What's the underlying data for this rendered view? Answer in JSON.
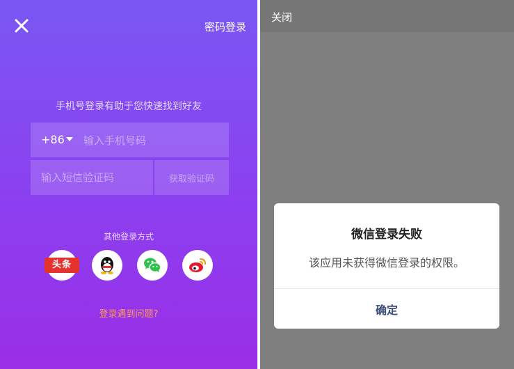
{
  "left": {
    "password_login": "密码登录",
    "hint": "手机号登录有助于您快速找到好友",
    "country_code": "+86",
    "phone_placeholder": "输入手机号码",
    "code_placeholder": "输入短信验证码",
    "get_code": "获取验证码",
    "other_login": "其他登录方式",
    "social": {
      "toutiao_label": "头条",
      "icons": [
        "toutiao-icon",
        "qq-icon",
        "wechat-icon",
        "weibo-icon"
      ]
    },
    "problem_link": "登录遇到问题?",
    "colors": {
      "gradient_top": "#7a57f2",
      "gradient_bottom": "#9a2ee6",
      "link": "#ff9a5c"
    }
  },
  "right": {
    "close_label": "关闭",
    "dialog": {
      "title": "微信登录失败",
      "message": "该应用未获得微信登录的权限。",
      "confirm": "确定"
    }
  }
}
